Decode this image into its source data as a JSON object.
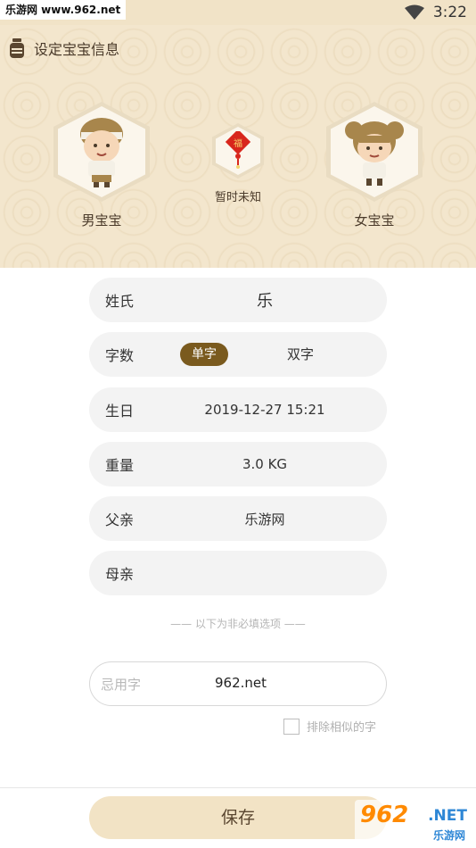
{
  "status_bar": {
    "watermark": "乐游网 www.962.net",
    "time": "3:22",
    "icons": [
      "wifi-icon"
    ]
  },
  "header": {
    "title": "设定宝宝信息",
    "title_icon": "jar-icon",
    "boy_label": "男宝宝",
    "girl_label": "女宝宝",
    "unknown_label": "暂时未知",
    "unknown_charm_text": "福",
    "background_color": "#f3e6cd"
  },
  "form": {
    "surname": {
      "label": "姓氏",
      "value": "乐"
    },
    "char_count": {
      "label": "字数",
      "options": [
        "单字",
        "双字"
      ],
      "selected": "单字"
    },
    "birthday": {
      "label": "生日",
      "value": "2019-12-27 15:21"
    },
    "weight": {
      "label": "重量",
      "value": "3.0 KG"
    },
    "father": {
      "label": "父亲",
      "value": "乐游网"
    },
    "mother": {
      "label": "母亲",
      "value": ""
    },
    "optional_divider": "—— 以下为非必填选项 ——",
    "avoid_chars": {
      "placeholder": "忌用字",
      "value": "962.net"
    },
    "exclude_similar": {
      "label": "排除相似的字",
      "checked": false
    }
  },
  "bottom": {
    "save_label": "保存",
    "watermark": {
      "num": "962",
      "net": ".NET",
      "cn": "乐游网"
    }
  },
  "colors": {
    "accent": "#7a5a1e",
    "field_bg": "#f3f3f3",
    "save_bg": "#f2e3c5"
  }
}
